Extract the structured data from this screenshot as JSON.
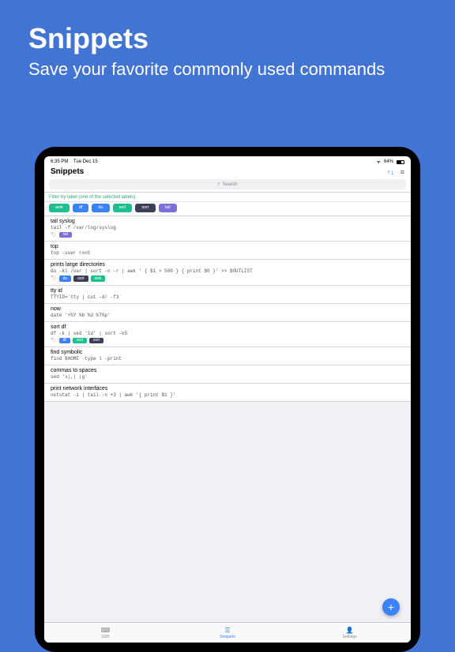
{
  "hero": {
    "title": "Snippets",
    "subtitle": "Save your favorite commonly used commands"
  },
  "status": {
    "time": "6:35 PM",
    "date": "Tue Dec 15",
    "battery": "64%"
  },
  "navbar": {
    "title": "Snippets"
  },
  "search": {
    "placeholder": "Search"
  },
  "filter": {
    "header": "Filter by label (one of the selected labels)",
    "labels": [
      {
        "name": "awk",
        "color": "#1dbf8e"
      },
      {
        "name": "df",
        "color": "#3b82f6"
      },
      {
        "name": "du",
        "color": "#3b82f6"
      },
      {
        "name": "sed",
        "color": "#1dbf8e"
      },
      {
        "name": "sort",
        "color": "#3a3f58"
      },
      {
        "name": "tail",
        "color": "#7c6fd8"
      }
    ]
  },
  "snippets": [
    {
      "title": "tail syslog",
      "cmd": "tail -f /var/log/syslog",
      "tags": [
        {
          "name": "tail",
          "color": "#7c6fd8"
        }
      ]
    },
    {
      "title": "top",
      "cmd": "top -user root",
      "tags": []
    },
    {
      "title": "prints large directories",
      "cmd": "du -kl /var | sort -n -r | awk ' { $1 > 500 } { print $0 }' >> $OUTLIST",
      "tags": [
        {
          "name": "du",
          "color": "#3b82f6"
        },
        {
          "name": "sort",
          "color": "#3a3f58"
        },
        {
          "name": "awk",
          "color": "#1dbf8e"
        }
      ]
    },
    {
      "title": "tty id",
      "cmd": "TTYID=`tty | cut -d/ -f3`",
      "tags": []
    },
    {
      "title": "now",
      "cmd": "date '+%Y %b %d %T%p'",
      "tags": []
    },
    {
      "title": "sort df",
      "cmd": "df -k | sed '1d' | sort -k5",
      "tags": [
        {
          "name": "df",
          "color": "#3b82f6"
        },
        {
          "name": "sed",
          "color": "#1dbf8e"
        },
        {
          "name": "sort",
          "color": "#3a3f58"
        }
      ]
    },
    {
      "title": "find symbolic",
      "cmd": "find $HOME -type l -print",
      "tags": []
    },
    {
      "title": "commas to spaces",
      "cmd": "sed 's|,| |g'",
      "tags": []
    },
    {
      "title": "print network interfaces",
      "cmd": "netstat -i | tail -n +3 | awk '{ print $1 }'",
      "tags": []
    }
  ],
  "tabs": [
    {
      "label": "SSH",
      "icon": "⌨"
    },
    {
      "label": "Snippets",
      "icon": "☰"
    },
    {
      "label": "Settings",
      "icon": "👤"
    }
  ],
  "active_tab": 1
}
